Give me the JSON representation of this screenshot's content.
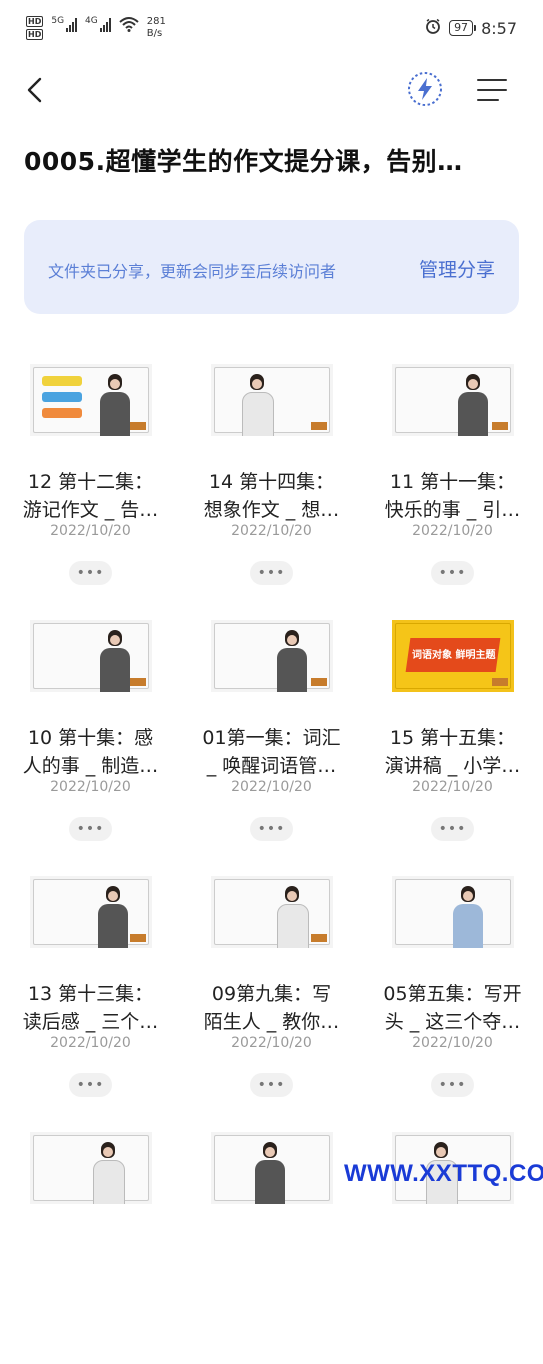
{
  "status_bar": {
    "sim1": "HD",
    "sim2": "HD",
    "net1": "5G",
    "net2": "4G",
    "speed_value": "281",
    "speed_unit": "B/s",
    "battery": "97",
    "time": "8:57",
    "icons": [
      "signal-icon",
      "wifi-icon",
      "alarm-icon",
      "battery-icon"
    ]
  },
  "nav": {
    "back_icon": "chevron-left-icon",
    "flash_icon": "lightning-icon",
    "menu_icon": "menu-icon",
    "accent": "#4a6fd0"
  },
  "title": "0005.超懂学生的作文提分课，告别…",
  "share": {
    "notice": "文件夹已分享，更新会同步至后续访问者",
    "manage_label": "管理分享",
    "bg_color": "#e8edfb",
    "text_color": "#5b7fd6"
  },
  "items": [
    {
      "line1": "12 第十二集：",
      "line2": "游记作文 _ 告…",
      "date": "2022/10/20",
      "more": "•••"
    },
    {
      "line1": "14 第十四集：",
      "line2": "想象作文 _ 想…",
      "date": "2022/10/20",
      "more": "•••"
    },
    {
      "line1": "11 第十一集：",
      "line2": "快乐的事 _ 引…",
      "date": "2022/10/20",
      "more": "•••"
    },
    {
      "line1": "10 第十集：感",
      "line2": "人的事 _ 制造…",
      "date": "2022/10/20",
      "more": "•••"
    },
    {
      "line1": "01第一集：词汇",
      "line2": "_ 唤醒词语管…",
      "date": "2022/10/20",
      "more": "•••"
    },
    {
      "line1": "15 第十五集：",
      "line2": "演讲稿 _ 小学…",
      "date": "2022/10/20",
      "more": "•••"
    },
    {
      "line1": "13 第十三集：",
      "line2": "读后感 _ 三个…",
      "date": "2022/10/20",
      "more": "•••"
    },
    {
      "line1": "09第九集：写",
      "line2": "陌生人 _ 教你…",
      "date": "2022/10/20",
      "more": "•••"
    },
    {
      "line1": "05第五集：写开",
      "line2": "头 _ 这三个夺…",
      "date": "2022/10/20",
      "more": "•••"
    }
  ],
  "thumb_15_text": "词语对象  鲜明主题",
  "watermark": "WWW.XXTTQ.COM"
}
